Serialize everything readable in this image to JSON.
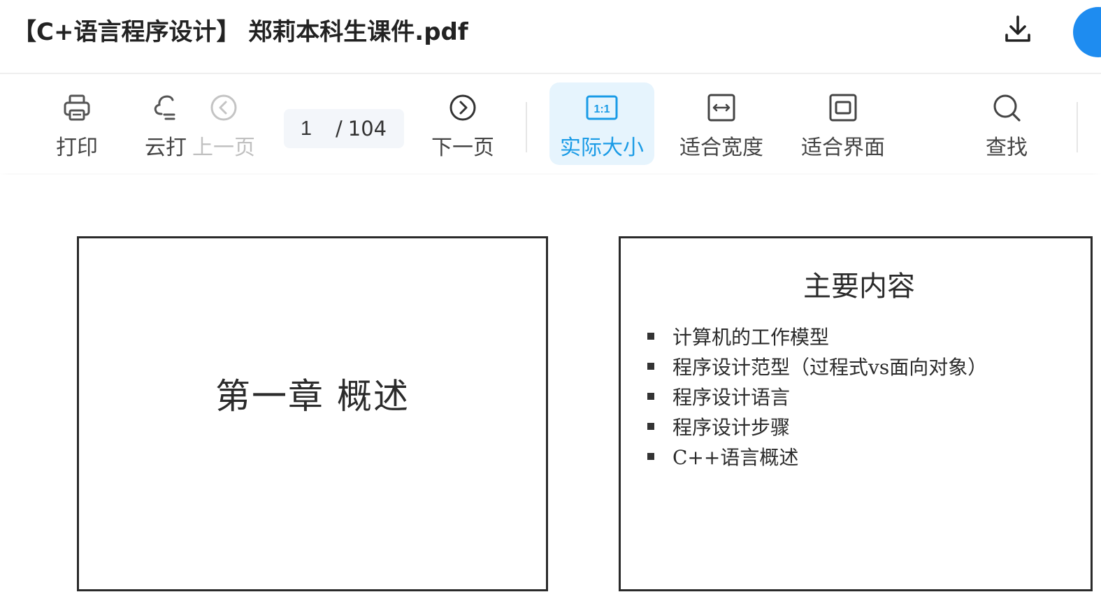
{
  "header": {
    "title": "【C+语言程序设计】 郑莉本科生课件.pdf",
    "download_icon": "download-icon"
  },
  "toolbar": {
    "print": {
      "label": "打印",
      "icon": "printer-icon"
    },
    "cloud_print": {
      "label": "云打",
      "icon": "cloud-print-icon"
    },
    "prev_page": {
      "label": "上一页",
      "icon": "chevron-left-circle-icon",
      "disabled": true
    },
    "page_input": {
      "current": "1",
      "separator": "/",
      "total": "104"
    },
    "next_page": {
      "label": "下一页",
      "icon": "chevron-right-circle-icon"
    },
    "actual_size": {
      "label": "实际大小",
      "icon_text": "1:1",
      "active": true
    },
    "fit_width": {
      "label": "适合宽度",
      "icon": "fit-width-icon"
    },
    "fit_page": {
      "label": "适合界面",
      "icon": "fit-page-icon"
    },
    "find": {
      "label": "查找",
      "icon": "search-icon"
    }
  },
  "colors": {
    "accent": "#1a9be6",
    "active_bg": "#e6f4fd",
    "avatar": "#1e8cf0"
  },
  "pages": [
    {
      "title": "第一章 概述"
    },
    {
      "title": "主要内容",
      "bullets": [
        "计算机的工作模型",
        "程序设计范型（过程式vs面向对象）",
        "程序设计语言",
        "程序设计步骤",
        "C++语言概述"
      ]
    }
  ]
}
